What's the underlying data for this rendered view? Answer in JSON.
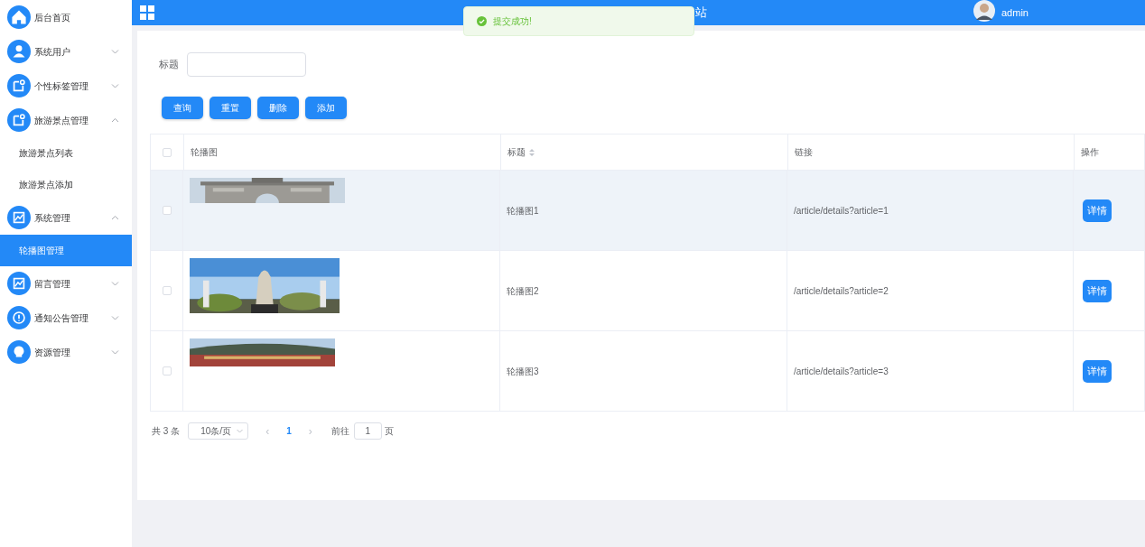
{
  "header": {
    "title_visible": "站",
    "user": "admin"
  },
  "toast": {
    "message": "提交成功!"
  },
  "sidebar": {
    "items": [
      {
        "label": "后台首页",
        "kind": "link"
      },
      {
        "label": "系统用户",
        "kind": "group",
        "expanded": false
      },
      {
        "label": "个性标签管理",
        "kind": "group",
        "expanded": false
      },
      {
        "label": "旅游景点管理",
        "kind": "group",
        "expanded": true,
        "children": [
          {
            "label": "旅游景点列表",
            "selected": false
          },
          {
            "label": "旅游景点添加",
            "selected": false
          }
        ]
      },
      {
        "label": "系统管理",
        "kind": "group",
        "expanded": true,
        "children": [
          {
            "label": "轮播图管理",
            "selected": true
          }
        ]
      },
      {
        "label": "留言管理",
        "kind": "group",
        "expanded": false
      },
      {
        "label": "通知公告管理",
        "kind": "group",
        "expanded": false
      },
      {
        "label": "资源管理",
        "kind": "group",
        "expanded": false
      }
    ]
  },
  "search": {
    "label": "标题"
  },
  "buttons": [
    "查询",
    "重置",
    "删除",
    "添加"
  ],
  "table": {
    "all_checked": false,
    "columns": [
      {
        "label": "轮播图",
        "sortable": false
      },
      {
        "label": "标题",
        "sortable": true
      },
      {
        "label": "链接",
        "sortable": false
      },
      {
        "label": "操作",
        "sortable": false
      }
    ],
    "rows": [
      {
        "checked": false,
        "title": "轮播图1",
        "link": "/article/details?article=1",
        "action": "详情",
        "highlighted": true
      },
      {
        "checked": false,
        "title": "轮播图2",
        "link": "/article/details?article=2",
        "action": "详情",
        "highlighted": false
      },
      {
        "checked": false,
        "title": "轮播图3",
        "link": "/article/details?article=3",
        "action": "详情",
        "highlighted": false
      }
    ]
  },
  "pagination": {
    "total": "共 3 条",
    "page_size": "10条/页",
    "prev": "‹",
    "current": "1",
    "next": "›",
    "goto_label": "前往",
    "goto_value": "1",
    "goto_suffix": "页"
  }
}
